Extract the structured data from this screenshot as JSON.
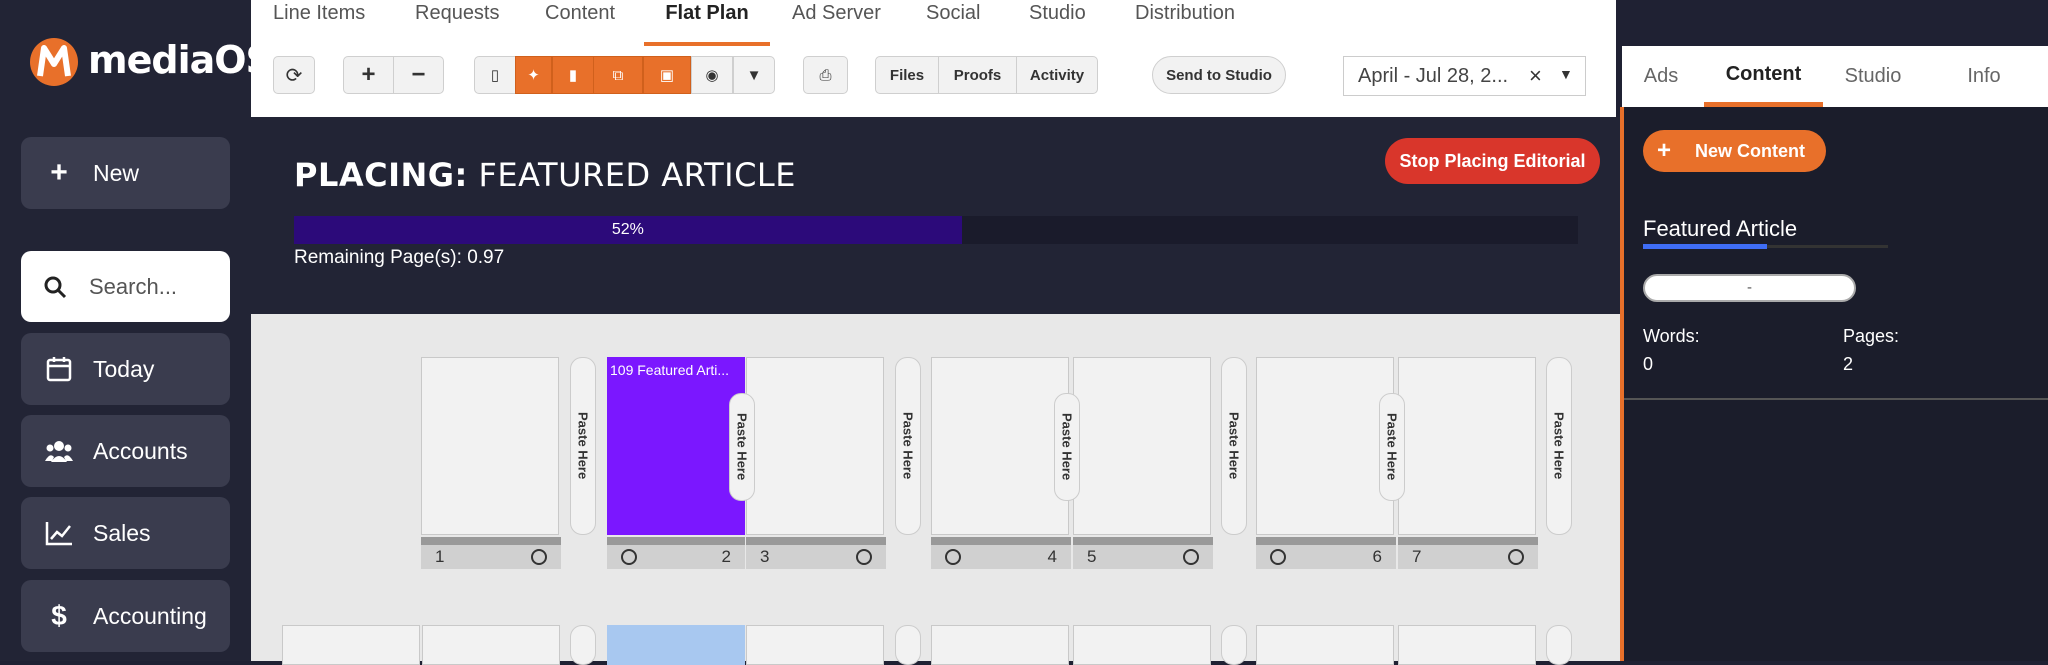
{
  "app": {
    "brand": "mediaOS"
  },
  "sidebar": {
    "new_label": "New",
    "search_placeholder": "Search...",
    "items": [
      {
        "label": "Today"
      },
      {
        "label": "Accounts"
      },
      {
        "label": "Sales"
      },
      {
        "label": "Accounting"
      }
    ]
  },
  "topnav": {
    "tabs": [
      {
        "label": "Line Items"
      },
      {
        "label": "Requests"
      },
      {
        "label": "Content"
      },
      {
        "label": "Flat Plan"
      },
      {
        "label": "Ad Server"
      },
      {
        "label": "Social"
      },
      {
        "label": "Studio"
      },
      {
        "label": "Distribution"
      }
    ],
    "active": "Flat Plan"
  },
  "toolbar": {
    "files": "Files",
    "proofs": "Proofs",
    "activity": "Activity",
    "send_to_studio": "Send to Studio",
    "date_range": "April - Jul 28, 2..."
  },
  "right_tabs": {
    "tabs": [
      {
        "label": "Ads"
      },
      {
        "label": "Content"
      },
      {
        "label": "Studio"
      },
      {
        "label": "Info"
      }
    ],
    "active": "Content"
  },
  "placing": {
    "prefix": "PLACING:",
    "title": "FEATURED ARTICLE",
    "stop_button": "Stop Placing Editorial",
    "progress_label": "52%",
    "progress": 0.52,
    "remaining": "Remaining Page(s): 0.97"
  },
  "content_panel": {
    "new_button": "New Content",
    "article_title": "Featured Article",
    "status_value": "-",
    "words_label": "Words:",
    "words_value": "0",
    "pages_label": "Pages:",
    "pages_value": "2"
  },
  "flatplan": {
    "paste_label": "Paste Here",
    "placed_label": "109 Featured Arti...",
    "pages": [
      "1",
      "2",
      "3",
      "4",
      "5",
      "6",
      "7"
    ]
  },
  "colors": {
    "accent": "#e8702a",
    "progress": "#2c0a7a",
    "placed": "#7b17ff",
    "stop": "#d9362b"
  }
}
